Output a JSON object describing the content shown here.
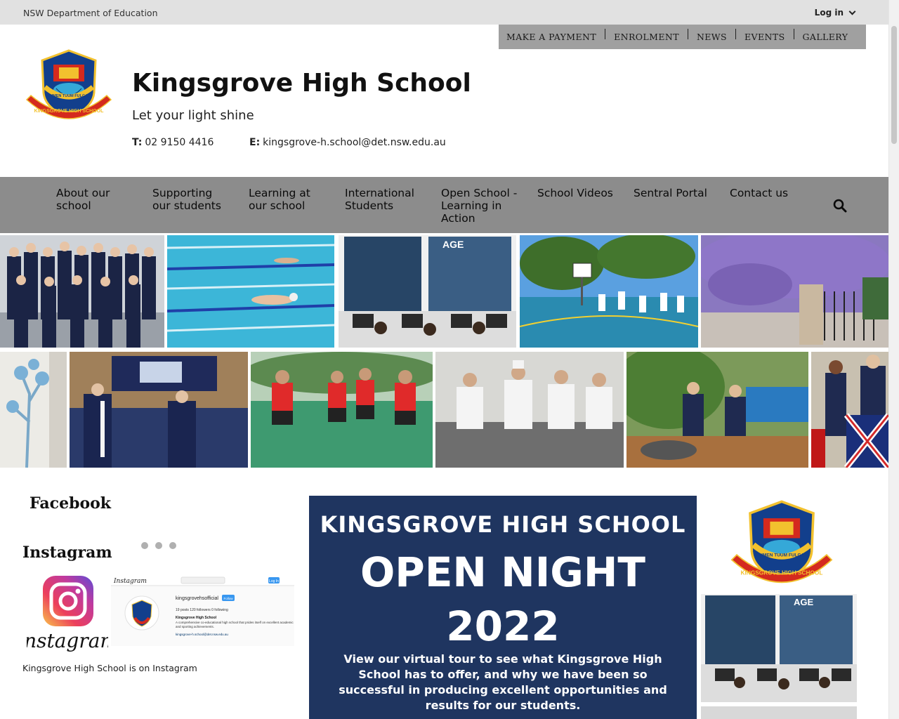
{
  "topbar": {
    "department": "NSW Department of Education",
    "login": "Log in"
  },
  "quicklinks": [
    "MAKE A PAYMENT",
    "ENROLMENT",
    "NEWS",
    "EVENTS",
    "GALLERY"
  ],
  "header": {
    "school_name": "Kingsgrove High School",
    "tagline": "Let your light shine",
    "phone_label": "T:",
    "phone": "02 9150 4416",
    "email_label": "E:",
    "email": "kingsgrove-h.school@det.nsw.edu.au",
    "crest_motto": "LUMEN TUUM FULGAT",
    "crest_name": "KINGSGROVE HIGH SCHOOL"
  },
  "nav": {
    "items": [
      [
        "About our",
        "school"
      ],
      [
        "Supporting",
        "our students"
      ],
      [
        "Learning at",
        "our school"
      ],
      [
        "International",
        "Students"
      ],
      [
        "Open School -",
        "Learning in",
        "Action"
      ],
      [
        "School Videos"
      ],
      [
        "Sentral Portal"
      ],
      [
        "Contact us"
      ]
    ],
    "search_icon": "search-icon"
  },
  "gallery": {
    "photos": [
      "students-group-photo",
      "swimming-pool-photo",
      "computer-lab-photo",
      "basketball-court-photo",
      "jacaranda-gate-photo",
      "mural-photo",
      "graduation-hall-photo",
      "netball-photo",
      "hospitality-kitchen-photo",
      "garden-photo",
      "flag-students-photo"
    ]
  },
  "social": {
    "facebook_heading": "Facebook",
    "instagram_heading": "Instagram",
    "instagram_logo_text": "Instagram",
    "instagram_caption": "Kingsgrove High School is on Instagram",
    "preview": {
      "brand": "Instagram",
      "login": "Log In",
      "username": "kingsgrovehsofficial",
      "follow": "Follow",
      "stats": "19 posts   120 followers   0 following",
      "profile_name": "Kingsgrove High School",
      "bio": "A comprehensive co-educational high school that prides itself on excellent academic and sporting achievements.",
      "link": "kingsgrove-h.school@det.nsw.edu.au"
    }
  },
  "poster": {
    "line1": "KINGSGROVE HIGH SCHOOL",
    "line2": "OPEN NIGHT",
    "line3": "2022",
    "line4": "View our virtual tour to see what Kingsgrove High School has to offer, and why we have been so successful in producing excellent opportunities and results for our students."
  },
  "colors": {
    "topbar": "#e1e1e1",
    "quicklinks": "#a0a0a0",
    "nav": "#8c8c8c",
    "poster": "#1f3560",
    "crest_red": "#d42a1e",
    "crest_blue": "#123f8c",
    "crest_gold": "#f2c12e"
  }
}
